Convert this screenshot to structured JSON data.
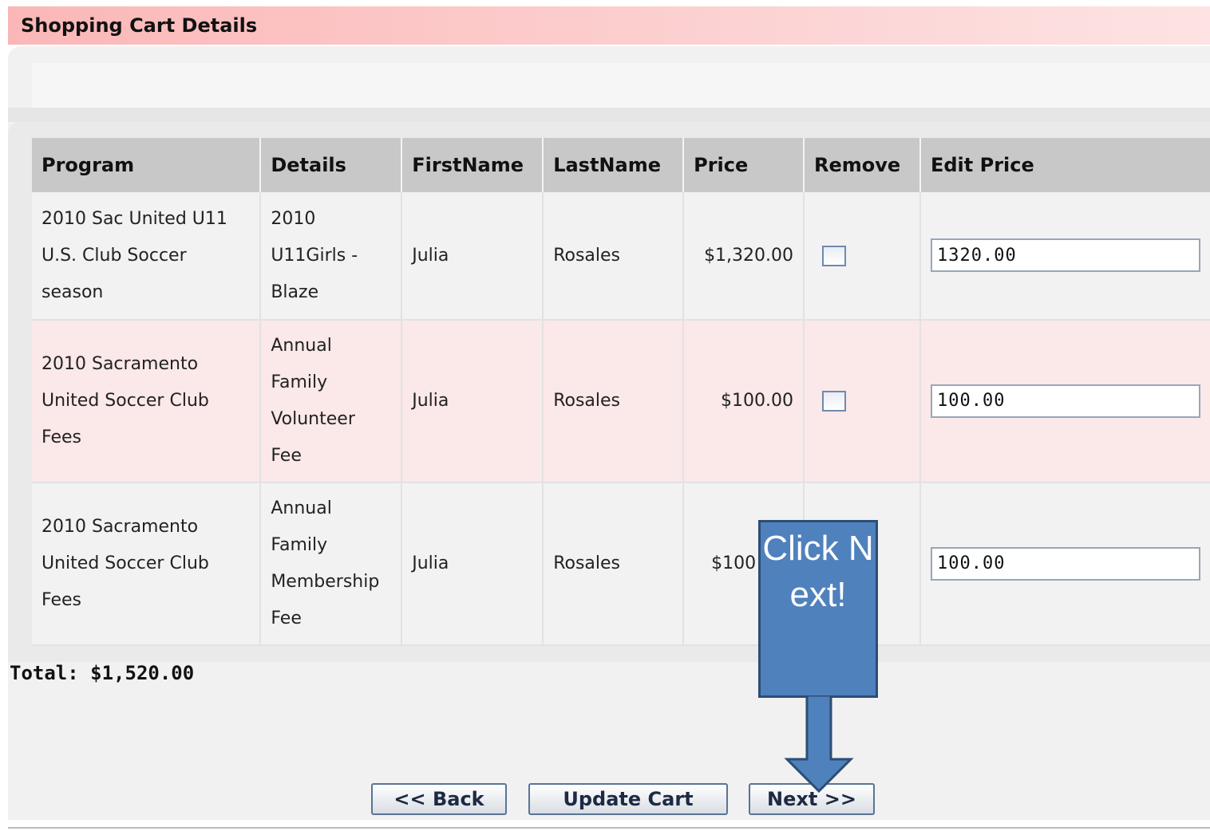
{
  "header": {
    "title": "Shopping Cart Details"
  },
  "table": {
    "columns": [
      "Program",
      "Details",
      "FirstName",
      "LastName",
      "Price",
      "Remove",
      "Edit Price"
    ],
    "rows": [
      {
        "program": [
          "2010 Sac United U11",
          "U.S. Club Soccer",
          "season"
        ],
        "details": [
          "2010",
          "U11Girls -",
          "Blaze"
        ],
        "first_name": "Julia",
        "last_name": "Rosales",
        "price": "$1,320.00",
        "remove_checked": false,
        "edit_price": "1320.00"
      },
      {
        "program": [
          "2010 Sacramento",
          "United Soccer Club",
          "Fees"
        ],
        "details": [
          "Annual",
          "Family",
          "Volunteer",
          "Fee"
        ],
        "first_name": "Julia",
        "last_name": "Rosales",
        "price": "$100.00",
        "remove_checked": false,
        "edit_price": "100.00"
      },
      {
        "program": [
          "2010 Sacramento",
          "United Soccer Club",
          "Fees"
        ],
        "details": [
          "Annual",
          "Family",
          "Membership",
          "Fee"
        ],
        "first_name": "Julia",
        "last_name": "Rosales",
        "price": "$100",
        "remove_checked": false,
        "edit_price": "100.00"
      }
    ]
  },
  "total": "Total: $1,520.00",
  "buttons": {
    "back": "<< Back",
    "update": "Update Cart",
    "next": "Next >>"
  },
  "callout": {
    "text": "Click Next!",
    "color": "#4f81bd"
  }
}
